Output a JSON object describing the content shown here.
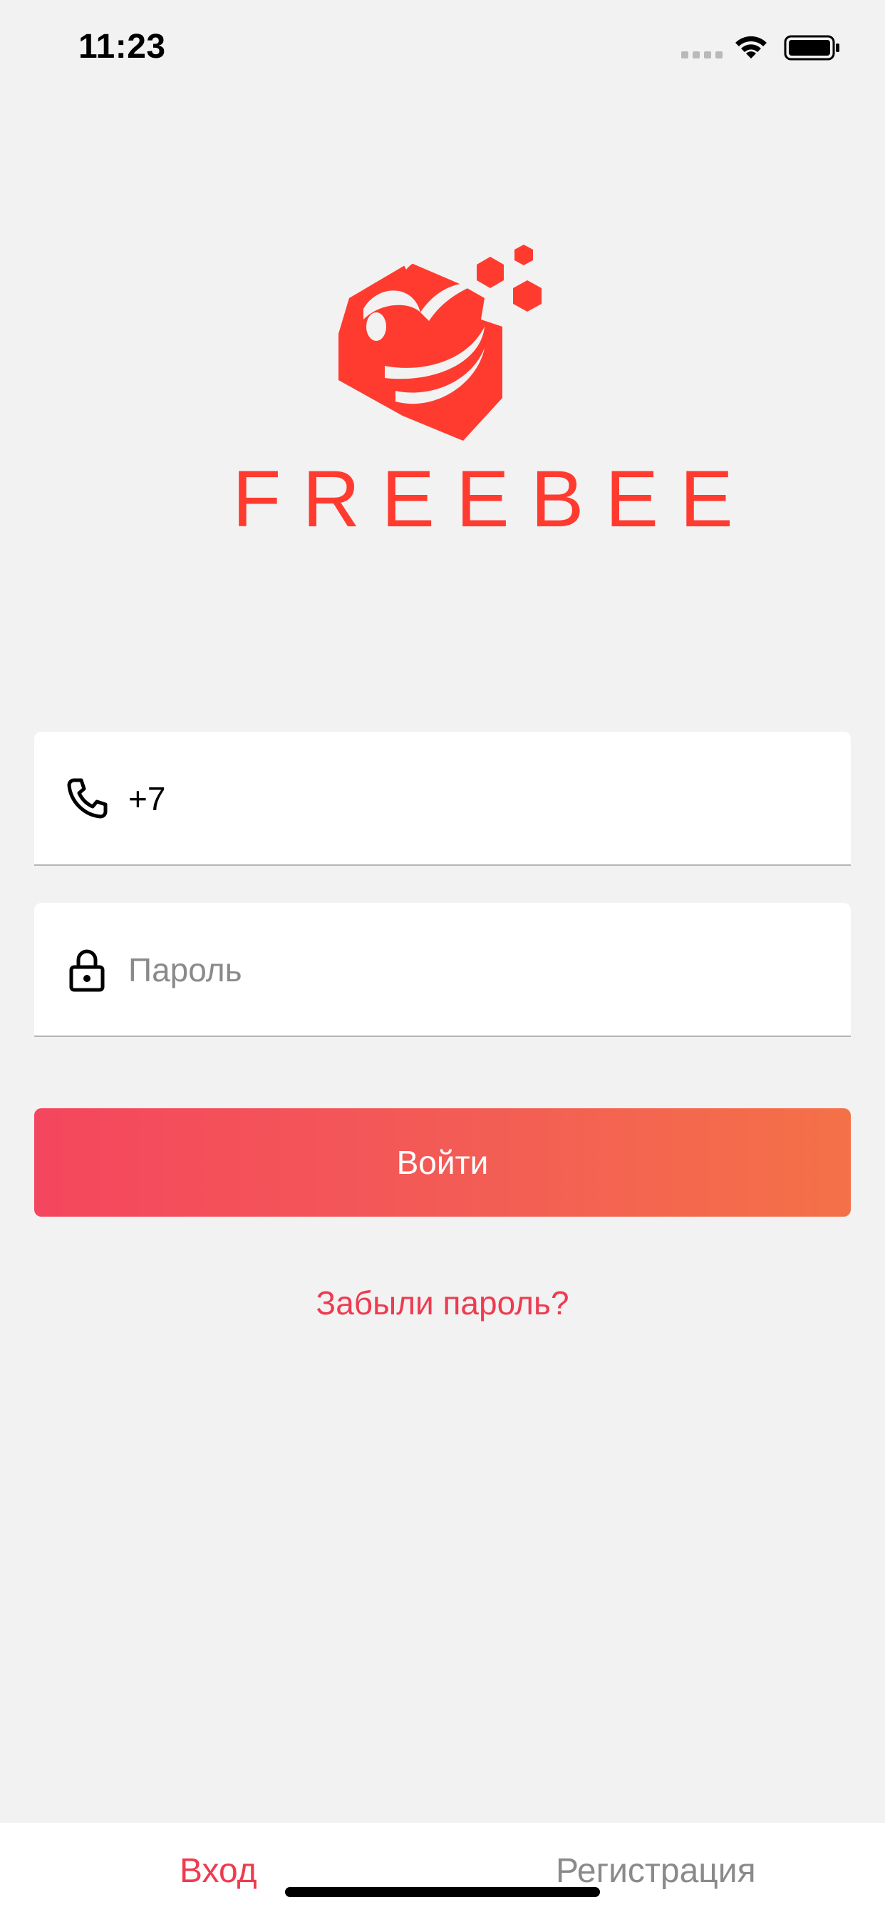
{
  "status_bar": {
    "time": "11:23",
    "icons": [
      "signal-dots-icon",
      "wifi-icon",
      "battery-icon"
    ]
  },
  "brand": {
    "name": "FREEBEE",
    "logo": "bee-hexagon-logo",
    "color": "#ff3b30"
  },
  "form": {
    "phone": {
      "icon": "phone-icon",
      "value": "+7",
      "placeholder": ""
    },
    "password": {
      "icon": "lock-icon",
      "value": "",
      "placeholder": "Пароль"
    },
    "login_label": "Войти",
    "forgot_label": "Забыли пароль?"
  },
  "tabs": {
    "login_label": "Вход",
    "register_label": "Регистрация",
    "active": "login"
  },
  "colors": {
    "accent": "#ee3b50",
    "gradient_start": "#f4465e",
    "gradient_end": "#f47148",
    "background": "#f2f2f2"
  }
}
